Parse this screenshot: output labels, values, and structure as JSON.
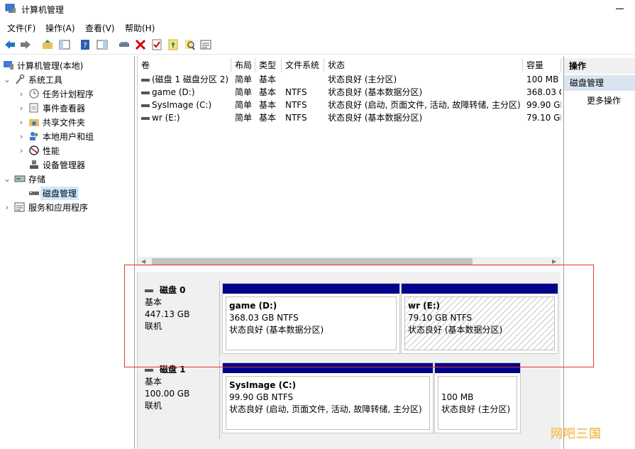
{
  "window": {
    "title": "计算机管理"
  },
  "menu": [
    "文件(F)",
    "操作(A)",
    "查看(V)",
    "帮助(H)"
  ],
  "toolbar": {
    "icons": [
      "back-icon",
      "forward-icon",
      "up-folder-icon",
      "console-tree-icon",
      "help-icon",
      "view-icon",
      "connect-icon",
      "delete-icon",
      "properties-icon",
      "export-icon",
      "search-icon",
      "list-icon"
    ]
  },
  "tree": {
    "root": "计算机管理(本地)",
    "system_tools": "系统工具",
    "task_scheduler": "任务计划程序",
    "event_viewer": "事件查看器",
    "shared_folders": "共享文件夹",
    "local_users": "本地用户和组",
    "performance": "性能",
    "device_manager": "设备管理器",
    "storage": "存储",
    "disk_management": "磁盘管理",
    "services_apps": "服务和应用程序"
  },
  "volume_list": {
    "headers": [
      "卷",
      "布局",
      "类型",
      "文件系统",
      "状态",
      "容量"
    ],
    "rows": [
      [
        "(磁盘 1 磁盘分区 2)",
        "简单",
        "基本",
        "",
        "状态良好 (主分区)",
        "100 MB"
      ],
      [
        "game (D:)",
        "简单",
        "基本",
        "NTFS",
        "状态良好 (基本数据分区)",
        "368.03 G"
      ],
      [
        "SysImage (C:)",
        "简单",
        "基本",
        "NTFS",
        "状态良好 (启动, 页面文件, 活动, 故障转储, 主分区)",
        "99.90 GE"
      ],
      [
        "wr (E:)",
        "简单",
        "基本",
        "NTFS",
        "状态良好 (基本数据分区)",
        "79.10 GE"
      ]
    ]
  },
  "disks": [
    {
      "name": "磁盘 0",
      "type": "基本",
      "size": "447.13 GB",
      "status": "联机",
      "partitions": [
        {
          "name": "game  (D:)",
          "size": "368.03 GB NTFS",
          "status": "状态良好 (基本数据分区)"
        },
        {
          "name": "wr  (E:)",
          "size": "79.10 GB NTFS",
          "status": "状态良好 (基本数据分区)"
        }
      ]
    },
    {
      "name": "磁盘 1",
      "type": "基本",
      "size": "100.00 GB",
      "status": "联机",
      "partitions": [
        {
          "name": "SysImage  (C:)",
          "size": "99.90 GB NTFS",
          "status": "状态良好 (启动, 页面文件, 活动, 故障转储, 主分区)"
        },
        {
          "name": "",
          "size": "100 MB",
          "status": "状态良好 (主分区)"
        }
      ]
    }
  ],
  "actions": {
    "title": "操作",
    "section": "磁盘管理",
    "more": "更多操作"
  },
  "watermark": "网吧三国",
  "colors": {
    "partition_bar": "#00008b",
    "highlight_box": "#e8342b",
    "selection": "#cce8ff"
  }
}
